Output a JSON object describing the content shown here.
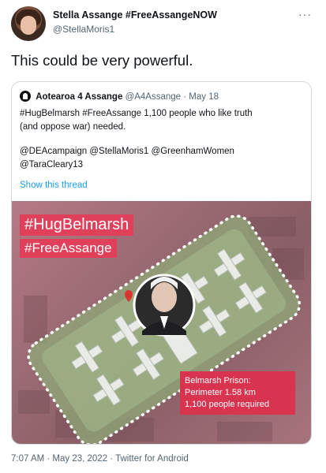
{
  "author": {
    "display_name": "Stella Assange #FreeAssangeNOW",
    "handle": "@StellaMoris1"
  },
  "tweet": {
    "text": "This could be very powerful.",
    "more_menu": "···",
    "footer": "7:07 AM · May 23, 2022 · Twitter for Android"
  },
  "quoted_tweet": {
    "display_name": "Aotearoa 4 Assange",
    "handle_date": "@A4Assange · May 18",
    "lines": [
      "#HugBelmarsh #FreeAssange 1,100 people who like  truth",
      "(and oppose war) needed.",
      "@DEAcampaign @StellaMoris1 @GreenhamWomen",
      "@TaraCleary13"
    ],
    "show_thread": "Show this thread"
  },
  "image": {
    "hashtag1": "#HugBelmarsh",
    "hashtag2": "#FreeAssange",
    "caption_lines": [
      "Belmarsh Prison:",
      "Perimeter 1.58 km",
      "1,100 people required"
    ]
  },
  "colors": {
    "link": "#1d9bf0",
    "hashtag_bg": "#e0405a",
    "perimeter_dots": "#ffffff"
  }
}
